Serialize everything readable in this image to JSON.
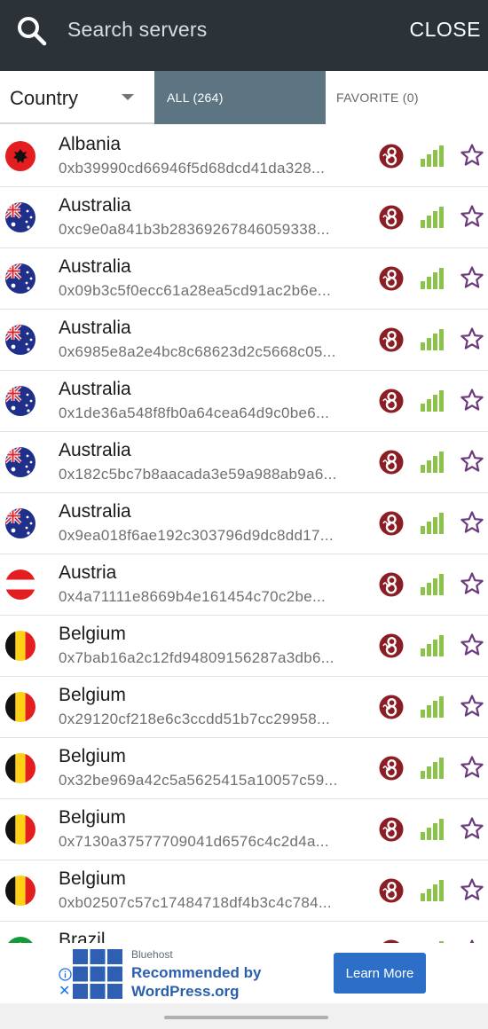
{
  "header": {
    "search_placeholder": "Search servers",
    "close_label": "CLOSE",
    "search_icon": "search-icon"
  },
  "filters": {
    "country_label": "Country",
    "tabs": [
      {
        "label": "ALL (264)",
        "active": true
      },
      {
        "label": "FAVORITE (0)",
        "active": false
      }
    ]
  },
  "colors": {
    "header_bg": "#2b3339",
    "active_tab_bg": "#5d7583",
    "protocol_icon": "#8b1e24",
    "signal_green": "#8bc34a",
    "star_purple": "#6b3a7d",
    "ad_button": "#2d6ec9"
  },
  "servers": [
    {
      "country": "Albania",
      "flag": "albania",
      "address": "0xb39990cd66946f5d68dcd41da328...",
      "signal": 4,
      "favorite": false
    },
    {
      "country": "Australia",
      "flag": "australia",
      "address": "0xc9e0a841b3b28369267846059338...",
      "signal": 4,
      "favorite": false
    },
    {
      "country": "Australia",
      "flag": "australia",
      "address": "0x09b3c5f0ecc61a28ea5cd91ac2b6e...",
      "signal": 4,
      "favorite": false
    },
    {
      "country": "Australia",
      "flag": "australia",
      "address": "0x6985e8a2e4bc8c68623d2c5668c05...",
      "signal": 4,
      "favorite": false
    },
    {
      "country": "Australia",
      "flag": "australia",
      "address": "0x1de36a548f8fb0a64cea64d9c0be6...",
      "signal": 4,
      "favorite": false
    },
    {
      "country": "Australia",
      "flag": "australia",
      "address": "0x182c5bc7b8aacada3e59a988ab9a6...",
      "signal": 4,
      "favorite": false
    },
    {
      "country": "Australia",
      "flag": "australia",
      "address": "0x9ea018f6ae192c303796d9dc8dd17...",
      "signal": 4,
      "favorite": false
    },
    {
      "country": "Austria",
      "flag": "austria",
      "address": "0x4a71111e8669b4e161454c70c2be...",
      "signal": 4,
      "favorite": false
    },
    {
      "country": "Belgium",
      "flag": "belgium",
      "address": "0x7bab16a2c12fd94809156287a3db6...",
      "signal": 4,
      "favorite": false
    },
    {
      "country": "Belgium",
      "flag": "belgium",
      "address": "0x29120cf218e6c3ccdd51b7cc29958...",
      "signal": 4,
      "favorite": false
    },
    {
      "country": "Belgium",
      "flag": "belgium",
      "address": "0x32be969a42c5a5625415a10057c59...",
      "signal": 4,
      "favorite": false
    },
    {
      "country": "Belgium",
      "flag": "belgium",
      "address": "0x7130a37577709041d6576c4c2d4a...",
      "signal": 4,
      "favorite": false
    },
    {
      "country": "Belgium",
      "flag": "belgium",
      "address": "0xb02507c57c17484718df4b3c4c784...",
      "signal": 4,
      "favorite": false
    },
    {
      "country": "Brazil",
      "flag": "brazil",
      "address": "",
      "signal": 4,
      "favorite": false
    }
  ],
  "ad": {
    "brand": "Bluehost",
    "headline": "Recommended by WordPress.org",
    "cta": "Learn More",
    "info_icon": "info-icon",
    "close_icon": "close-icon"
  }
}
